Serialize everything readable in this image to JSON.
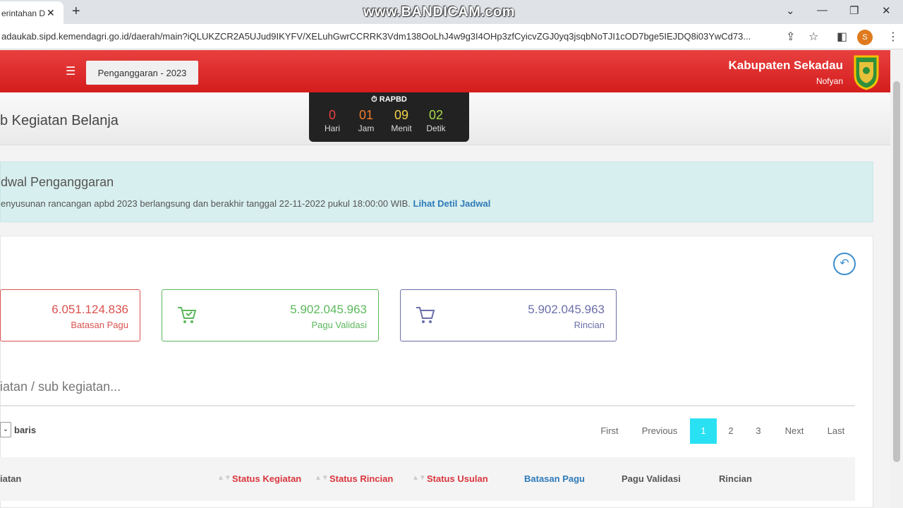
{
  "browser": {
    "tab_title": "erintahan D",
    "watermark": "www.BANDICAM.com",
    "url": "adaukab.sipd.kemendagri.go.id/daerah/main?iQLUKZCR2A5UJud9IKYFV/XELuhGwrCCRRK3Vdm138OoLhJ4w9g3I4OHp3zfCyicvZGJ0yq3jsqbNoTJI1cOD7bge5IEJDQ8i03YwCd73...",
    "profile_initial": "S"
  },
  "header": {
    "period_label": "Penganggaran - 2023",
    "region": "Kabupaten Sekadau",
    "user": "Nofyan"
  },
  "countdown": {
    "title": "RAPBD",
    "items": [
      {
        "value": "0",
        "unit": "Hari",
        "color": "#e8403f"
      },
      {
        "value": "01",
        "unit": "Jam",
        "color": "#f07a2a"
      },
      {
        "value": "09",
        "unit": "Menit",
        "color": "#f3d34a"
      },
      {
        "value": "02",
        "unit": "Detik",
        "color": "#a8d84a"
      }
    ]
  },
  "page": {
    "title": "b Kegiatan Belanja"
  },
  "alert": {
    "title": "dwal Penganggaran",
    "text": "enyusunan rancangan apbd 2023 berlangsung dan berakhir tanggal 22-11-2022 pukul 18:00:00 WIB.",
    "link": "Lihat Detil Jadwal"
  },
  "stats": [
    {
      "value": "6.051.124.836",
      "label": "Batasan Pagu",
      "color": "#d9534f"
    },
    {
      "value": "5.902.045.963",
      "label": "Pagu Validasi",
      "color": "#5cb85c"
    },
    {
      "value": "5.902.045.963",
      "label": "Rincian",
      "color": "#6b6fa8"
    }
  ],
  "search": {
    "placeholder": "iatan / sub kegiatan..."
  },
  "rows": {
    "label": "baris"
  },
  "pagination": {
    "first": "First",
    "previous": "Previous",
    "pages": [
      "1",
      "2",
      "3"
    ],
    "active": "1",
    "next": "Next",
    "last": "Last"
  },
  "table": {
    "headers": [
      {
        "label": "iatan",
        "color": "#555"
      },
      {
        "label": "Status Kegiatan",
        "color": "#d9363e"
      },
      {
        "label": "Status Rincian",
        "color": "#d9363e"
      },
      {
        "label": "Status Usulan",
        "color": "#d9363e"
      },
      {
        "label": "Batasan Pagu",
        "color": "#2f7ab8"
      },
      {
        "label": "Pagu Validasi",
        "color": "#555"
      },
      {
        "label": "Rincian",
        "color": "#555"
      }
    ]
  }
}
